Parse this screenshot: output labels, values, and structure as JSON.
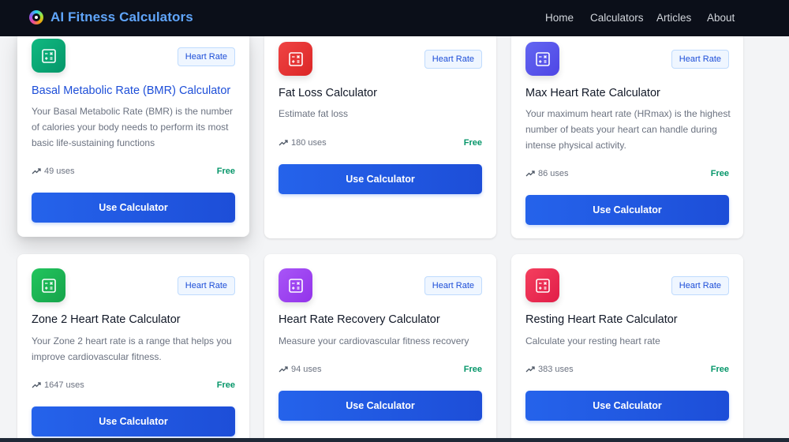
{
  "header": {
    "brand": "AI Fitness Calculators",
    "nav": [
      "Home",
      "Calculators",
      "Articles",
      "About"
    ]
  },
  "colors": {
    "accent": "#2563eb",
    "brand": "#60a5fa",
    "free": "#059669"
  },
  "cards": [
    {
      "icon": "calculator-icon",
      "icon_color": "#10b981",
      "category": "Heart Rate",
      "title": "Basal Metabolic Rate (BMR) Calculator",
      "description": "Your Basal Metabolic Rate (BMR) is the number of calories your body needs to perform its most basic life-sustaining functions",
      "uses": "49 uses",
      "price": "Free",
      "button": "Use Calculator"
    },
    {
      "icon": "calculator-icon",
      "icon_color": "#ef4444",
      "category": "Heart Rate",
      "title": "Fat Loss Calculator",
      "description": "Estimate fat loss",
      "uses": "180 uses",
      "price": "Free",
      "button": "Use Calculator"
    },
    {
      "icon": "calculator-icon",
      "icon_color": "#6366f1",
      "category": "Heart Rate",
      "title": "Max Heart Rate Calculator",
      "description": "Your maximum heart rate (HRmax) is the highest number of beats your heart can handle during intense physical activity.",
      "uses": "86 uses",
      "price": "Free",
      "button": "Use Calculator"
    },
    {
      "icon": "calculator-icon",
      "icon_color": "#22c55e",
      "category": "Heart Rate",
      "title": "Zone 2 Heart Rate Calculator",
      "description": "Your Zone 2 heart rate is a range that helps you improve cardiovascular fitness.",
      "uses": "1647 uses",
      "price": "Free",
      "button": "Use Calculator"
    },
    {
      "icon": "calculator-icon",
      "icon_color": "#a855f7",
      "category": "Heart Rate",
      "title": "Heart Rate Recovery Calculator",
      "description": "Measure your cardiovascular fitness recovery",
      "uses": "94 uses",
      "price": "Free",
      "button": "Use Calculator"
    },
    {
      "icon": "calculator-icon",
      "icon_color": "#f43f5e",
      "category": "Heart Rate",
      "title": "Resting Heart Rate Calculator",
      "description": "Calculate your resting heart rate",
      "uses": "383 uses",
      "price": "Free",
      "button": "Use Calculator"
    }
  ]
}
